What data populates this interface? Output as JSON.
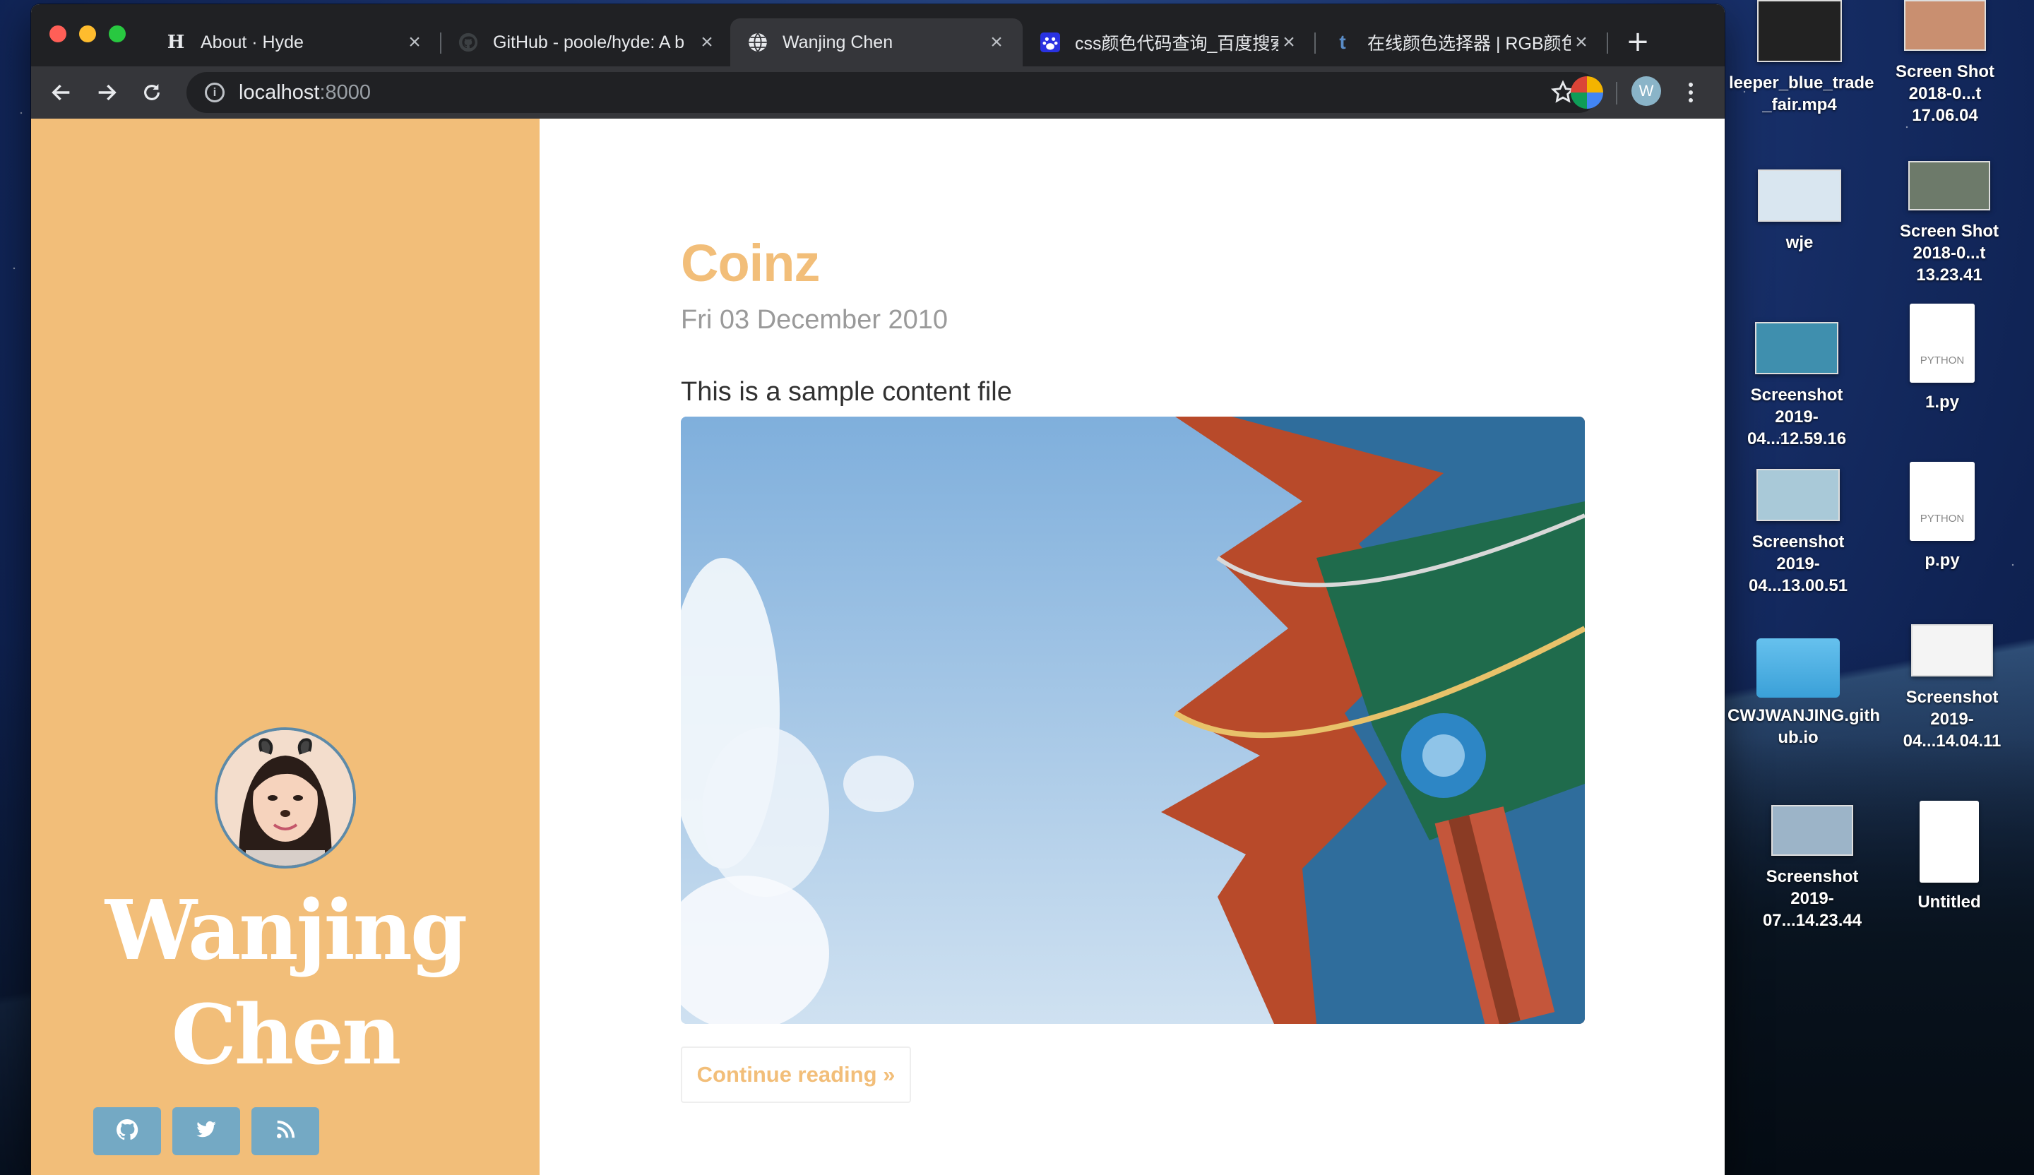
{
  "browser": {
    "tabs": [
      {
        "title": "About · Hyde",
        "favicon": "H",
        "close": "×"
      },
      {
        "title": "GitHub - poole/hyde: A b",
        "favicon": "github-icon",
        "close": "×"
      },
      {
        "title": "Wanjing Chen",
        "favicon": "globe-icon",
        "close": "×",
        "active": true
      },
      {
        "title": "css颜色代码查询_百度搜索",
        "favicon": "baidu-icon",
        "close": "×"
      },
      {
        "title": "在线颜色选择器 | RGB颜色",
        "favicon": "t",
        "close": "×"
      }
    ],
    "new_tab": "+",
    "url_host": "localhost",
    "url_port": ":8000",
    "profile_initial": "W"
  },
  "page": {
    "sidebar": {
      "title_line1": "Wanjing",
      "title_line2": "Chen",
      "bg_color": "#f2be79",
      "social": [
        "github-icon",
        "twitter-icon",
        "rss-icon"
      ]
    },
    "post": {
      "title": "Coinz",
      "date": "Fri 03 December 2010",
      "body": "This is a sample content file",
      "continue_label": "Continue reading »"
    }
  },
  "desktop": {
    "icons": [
      {
        "label_1": "leeper_blue_trade",
        "label_2": "_fair.mp4"
      },
      {
        "label_1": "Screen Shot",
        "label_2": "2018-0...t 17.06.04"
      },
      {
        "label_1": "wje",
        "label_2": ""
      },
      {
        "label_1": "Screen Shot",
        "label_2": "2018-0...t 13.23.41"
      },
      {
        "label_1": "Screenshot",
        "label_2": "2019-04...12.59.16"
      },
      {
        "label_1": "1.py",
        "label_2": "",
        "tag": "PYTHON"
      },
      {
        "label_1": "Screenshot",
        "label_2": "2019-04...13.00.51"
      },
      {
        "label_1": "p.py",
        "label_2": "",
        "tag": "PYTHON"
      },
      {
        "label_1": "CWJWANJING.gith",
        "label_2": "ub.io"
      },
      {
        "label_1": "Screenshot",
        "label_2": "2019-04...14.04.11"
      },
      {
        "label_1": "Screenshot",
        "label_2": "2019-07...14.23.44"
      },
      {
        "label_1": "Untitled",
        "label_2": ""
      }
    ]
  }
}
